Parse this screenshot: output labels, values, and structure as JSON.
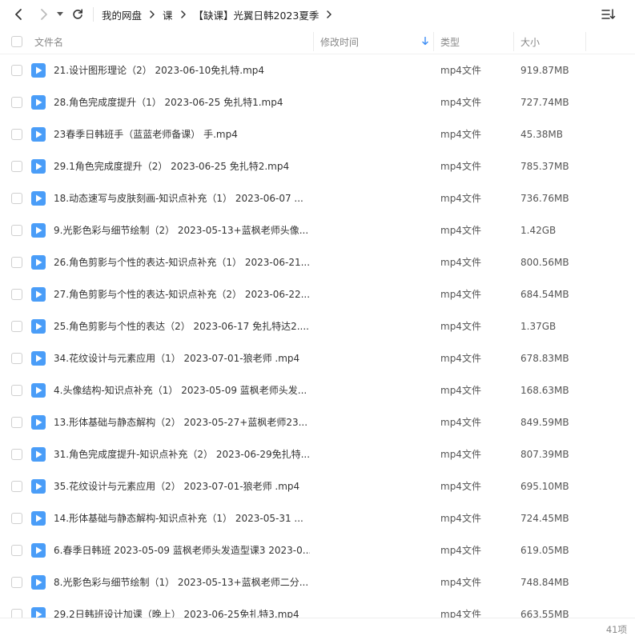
{
  "nav": {
    "breadcrumbs": [
      "我的网盘",
      "课",
      "【缺课】光翼日韩2023夏季"
    ]
  },
  "columns": {
    "name": "文件名",
    "modified": "修改时间",
    "type": "类型",
    "size": "大小"
  },
  "colors": {
    "accent": "#3b8cf5",
    "icon_blue": "#4a9df8"
  },
  "files": [
    {
      "name": "21.设计图形理论（2） 2023-06-10免扎特.mp4",
      "type": "mp4文件",
      "size": "919.87MB"
    },
    {
      "name": "28.角色完成度提升（1） 2023-06-25 免扎特1.mp4",
      "type": "mp4文件",
      "size": "727.74MB"
    },
    {
      "name": "23春季日韩班手（蓝蓝老师备课） 手.mp4",
      "type": "mp4文件",
      "size": "45.38MB"
    },
    {
      "name": "29.1角色完成度提升（2） 2023-06-25 免扎特2.mp4",
      "type": "mp4文件",
      "size": "785.37MB"
    },
    {
      "name": "18.动态速写与皮肤刻画-知识点补充（1） 2023-06-07 ...",
      "type": "mp4文件",
      "size": "736.76MB"
    },
    {
      "name": "9.光影色彩与细节绘制（2） 2023-05-13+蓝枫老师头像...",
      "type": "mp4文件",
      "size": "1.42GB"
    },
    {
      "name": "26.角色剪影与个性的表达-知识点补充（1） 2023-06-21...",
      "type": "mp4文件",
      "size": "800.56MB"
    },
    {
      "name": "27.角色剪影与个性的表达-知识点补充（2） 2023-06-22...",
      "type": "mp4文件",
      "size": "684.54MB"
    },
    {
      "name": "25.角色剪影与个性的表达（2） 2023-06-17 免扎特达2....",
      "type": "mp4文件",
      "size": "1.37GB"
    },
    {
      "name": "34.花纹设计与元素应用（1） 2023-07-01-狼老师 .mp4",
      "type": "mp4文件",
      "size": "678.83MB"
    },
    {
      "name": "4.头像结构-知识点补充（1） 2023-05-09 蓝枫老师头发...",
      "type": "mp4文件",
      "size": "168.63MB"
    },
    {
      "name": "13.形体基础与静态解构（2） 2023-05-27+蓝枫老师23...",
      "type": "mp4文件",
      "size": "849.59MB"
    },
    {
      "name": "31.角色完成度提升-知识点补充（2） 2023-06-29免扎特...",
      "type": "mp4文件",
      "size": "807.39MB"
    },
    {
      "name": "35.花纹设计与元素应用（2） 2023-07-01-狼老师 .mp4",
      "type": "mp4文件",
      "size": "695.10MB"
    },
    {
      "name": "14.形体基础与静态解构-知识点补充（1） 2023-05-31 ...",
      "type": "mp4文件",
      "size": "724.45MB"
    },
    {
      "name": "6.春季日韩班 2023-05-09 蓝枫老师头发造型课3 2023-0...",
      "type": "mp4文件",
      "size": "619.05MB"
    },
    {
      "name": "8.光影色彩与细节绘制（1） 2023-05-13+蓝枫老师二分...",
      "type": "mp4文件",
      "size": "748.84MB"
    },
    {
      "name": "29.2日韩班设计加课（晚上） 2023-06-25免扎特3.mp4",
      "type": "mp4文件",
      "size": "663.55MB"
    }
  ],
  "footer": {
    "count": "41项"
  }
}
